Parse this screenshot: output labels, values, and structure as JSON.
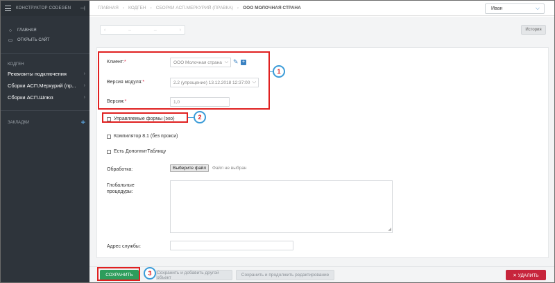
{
  "sidebar": {
    "title": "КОНСТРУКТОР CODEGEN",
    "links": [
      {
        "label": "ГЛАВНАЯ",
        "icon": "circle-icon"
      },
      {
        "label": "ОТКРЫТЬ САЙТ",
        "icon": "window-icon"
      }
    ],
    "section_label": "КОДГЕН",
    "items": [
      {
        "label": "Реквизиты подключения"
      },
      {
        "label": "Сборки АСП.Меркурий (пр..."
      },
      {
        "label": "Сборки АСП.Шлюз"
      }
    ],
    "bookmarks_label": "ЗАКЛАДКИ",
    "bookmarks_add": "+"
  },
  "topbar": {
    "breadcrumbs": [
      "ГЛАВНАЯ",
      "КОДГЕН",
      "СБОРКИ АСП.МЕРКУРИЙ (ПРАВКА)",
      "ООО МОЛОЧНАЯ СТРАНА"
    ],
    "user": "Иван"
  },
  "toolbar": {
    "history_label": "История"
  },
  "form": {
    "client_label": "Клиент:",
    "client_value": "ООО Молочная страна",
    "module_version_label": "Версия модуля:",
    "module_version_value": "2.2 (упрощение) 13.12.2018 12:37:00",
    "version_label": "Версия:",
    "version_value": "1,0",
    "managed_forms_label": "Управляемые формы (эхо)",
    "compiler_label": "Компилятор 8.1 (без прокси)",
    "extra_table_label": "Есть ДополнитТаблицу",
    "processing_label": "Обработка:",
    "file_button_label": "Выберите файл",
    "file_status": "Файл не выбран",
    "global_procs_label": "Глобальные процедуры:",
    "service_address_label": "Адрес службы:"
  },
  "annotations": [
    "1",
    "2",
    "3"
  ],
  "bottom": {
    "save_label": "СОХРАНИТЬ",
    "save_add_label": "Сохранить и добавить другой объект",
    "save_continue_label": "Сохранить и продолжить редактирование",
    "delete_label": "✕ УДАЛИТЬ"
  },
  "colors": {
    "sidebar_bg": "#2e343b",
    "save_green": "#2d9d5c",
    "delete_red": "#c7253c",
    "annotation_red": "#e02020",
    "callout_blue": "#3a9bd8"
  }
}
